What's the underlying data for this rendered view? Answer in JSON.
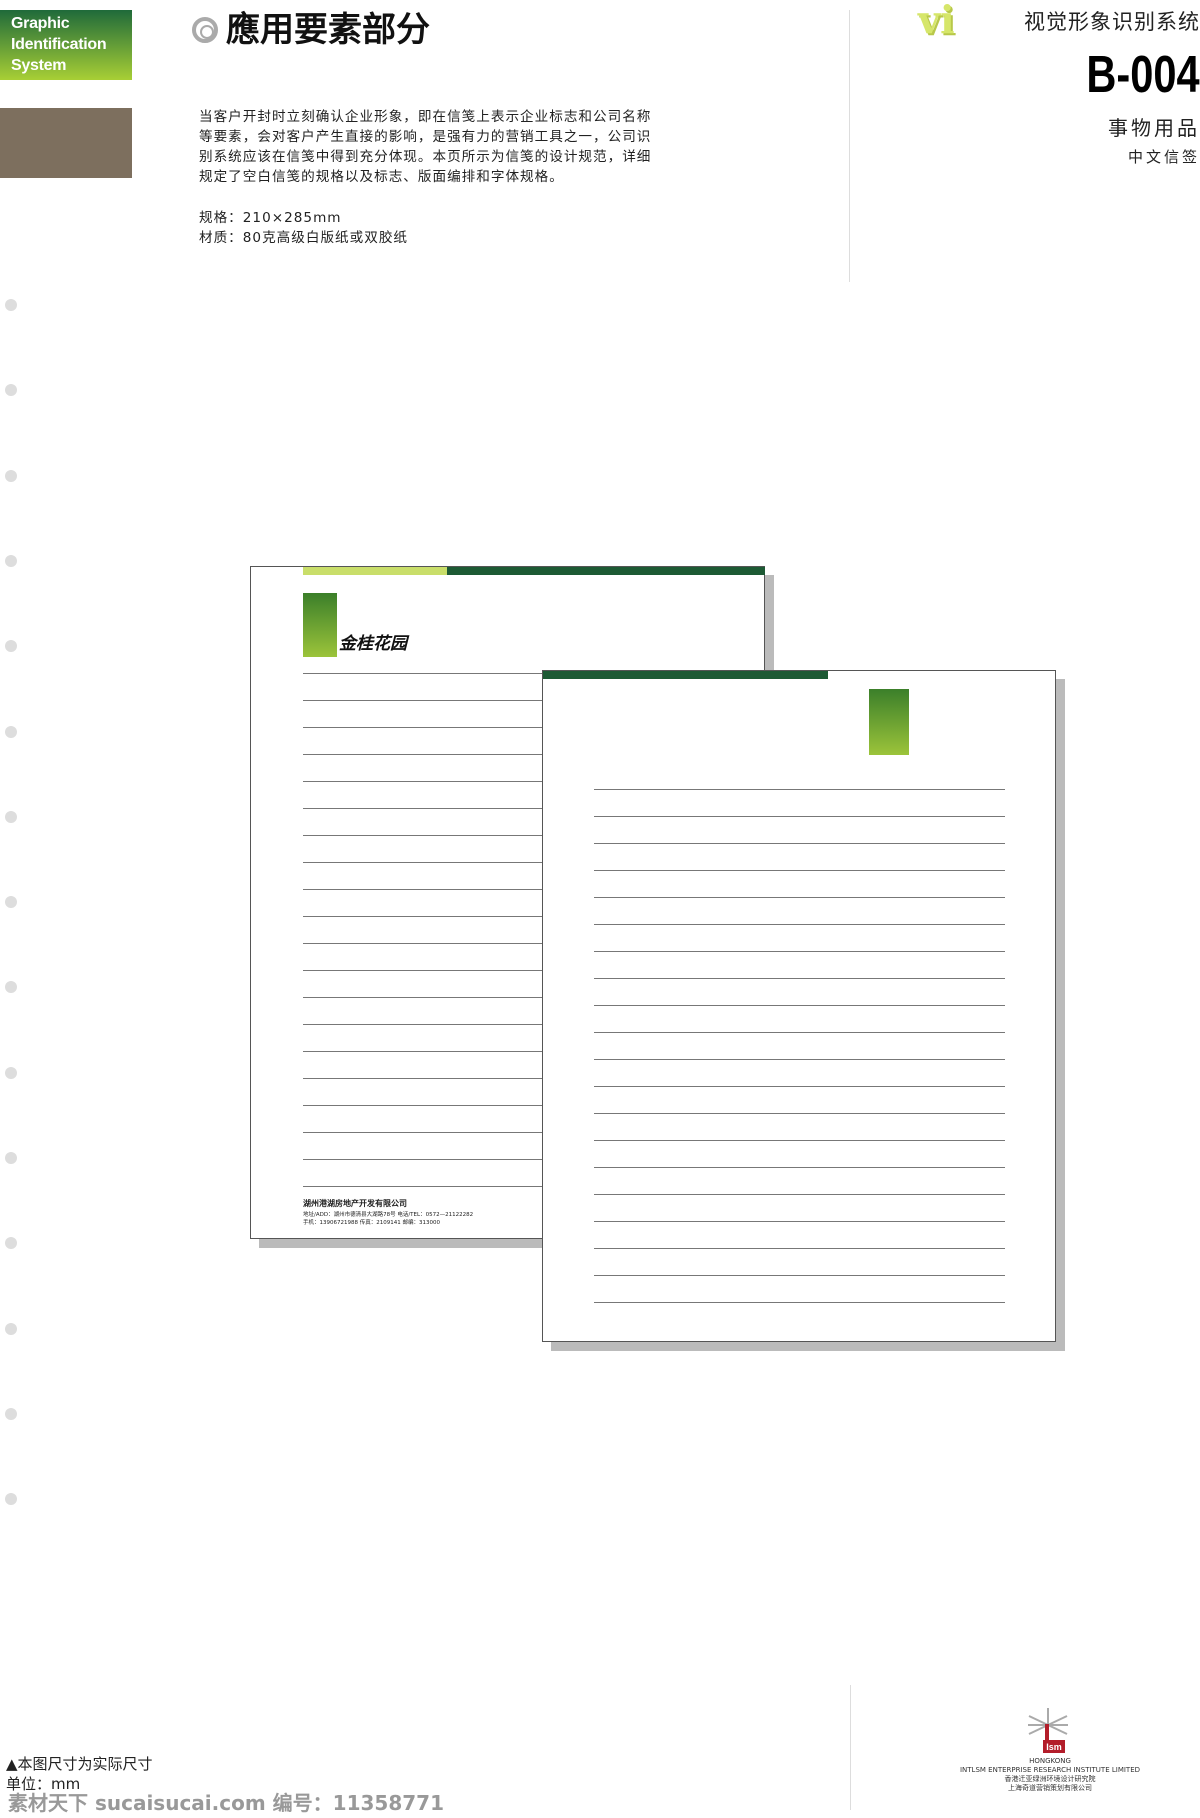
{
  "brand_box": {
    "lines": [
      "Graphic",
      "Identification",
      "System"
    ]
  },
  "colors": {
    "green_dark": "#1f6a3a",
    "green_light": "#a8cf35",
    "brown": "#7d6f5e",
    "bar_dark": "#1d5a34",
    "bar_light": "#c9de6a"
  },
  "header": {
    "title": "應用要素部分",
    "vi_logo": "vi",
    "system_title": "视觉形象识别系统",
    "code": "B-004",
    "category": "事物用品",
    "subcategory": "中文信签"
  },
  "description": [
    "当客户开封时立刻确认企业形象，即在信笺上表示企业标志和公司名称",
    "等要素，会对客户产生直接的影响，是强有力的营销工具之一，公司识",
    "别系统应该在信笺中得到充分体现。本页所示为信笺的设计规范，详细",
    "规定了空白信笺的规格以及标志、版面编排和字体规格。"
  ],
  "spec": {
    "size": "规格：210×285mm",
    "material": "材质：80克高级白版纸或双胶纸"
  },
  "letterhead": {
    "logo_text": "金桂花园",
    "company": "湖州港湖房地产开发有限公司",
    "address": "地址/ADD：湖州市德清县大湖路78号     电话/TEL：0572—21122282",
    "contact": "手机：13906721988     传真：2109141  邮编：313000"
  },
  "footer": {
    "note": "▲本图尺寸为实际尺寸",
    "unit": "单位：mm",
    "watermark": "素材天下 sucaisucai.com  编号：11358771"
  },
  "institute": {
    "mark": "Ism",
    "lines": [
      "HONGKONG",
      "INTLSM ENTERPRISE RESEARCH INSTITUTE LIMITED",
      "香港迁亚绿洲环境设计研究院",
      "上海奇道营销策划有限公司"
    ]
  }
}
